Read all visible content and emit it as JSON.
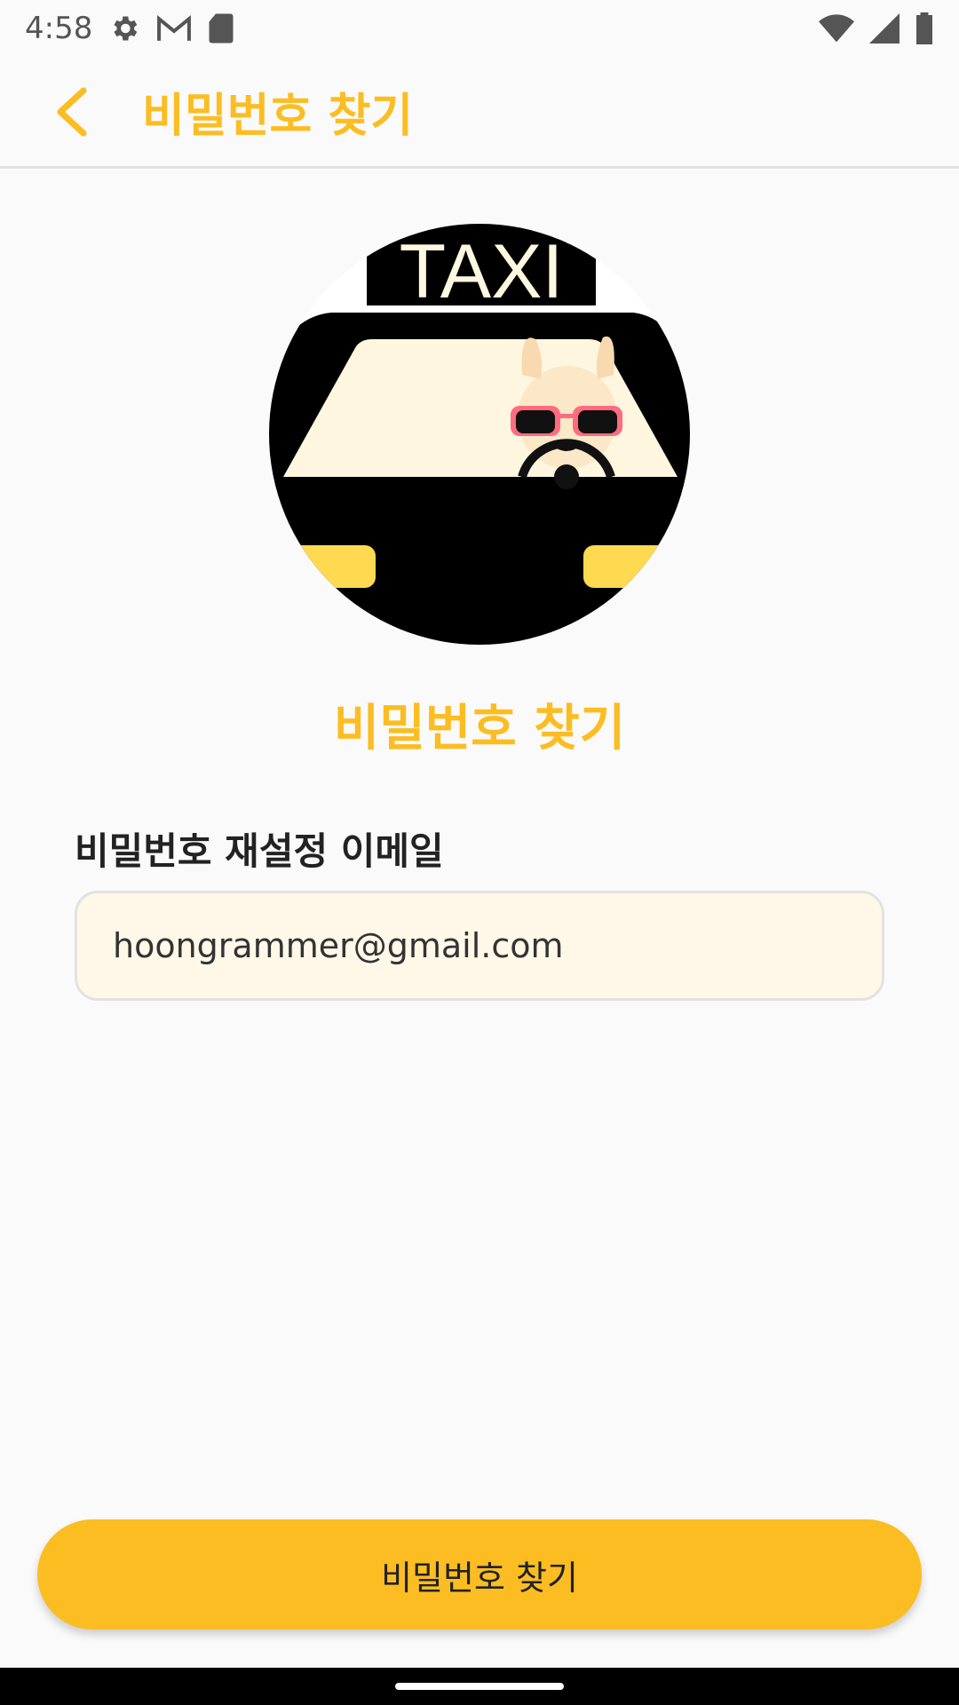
{
  "status_bar": {
    "time": "4:58",
    "left_icons": [
      "settings-icon",
      "gmail-icon",
      "sd-card-icon"
    ],
    "right_icons": [
      "wifi-icon",
      "signal-icon",
      "battery-icon"
    ]
  },
  "app_bar": {
    "back_icon": "chevron-left-icon",
    "title": "비밀번호 찾기"
  },
  "logo": {
    "sign_text": "TAXI"
  },
  "main": {
    "heading": "비밀번호 찾기",
    "email_label": "비밀번호 재설정 이메일",
    "email_value": "hoongrammer@gmail.com"
  },
  "submit_button": {
    "label": "비밀번호 찾기"
  },
  "colors": {
    "accent": "#fbbd22",
    "input_background": "#fff8e8",
    "background": "#fafafa"
  }
}
